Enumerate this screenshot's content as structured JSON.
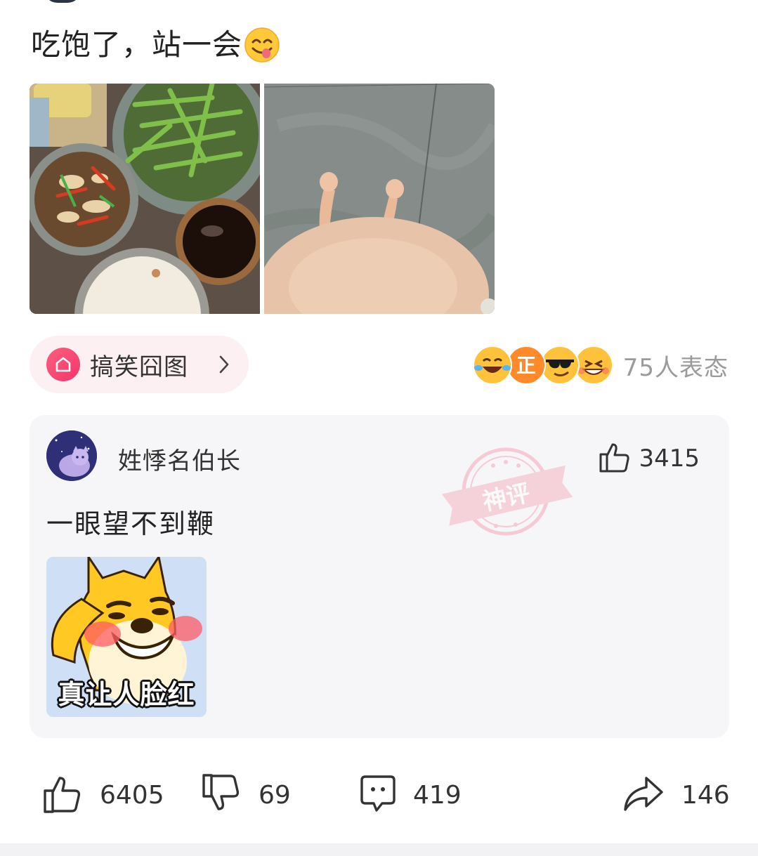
{
  "post": {
    "text": "吃饱了，站一会",
    "emoji": "savoring-food-emoji"
  },
  "topic": {
    "label": "搞笑囧图",
    "icon": "home-icon"
  },
  "reactions": {
    "count_label": "75人表态",
    "emojis": [
      "laughing-tears-emoji",
      "zheng-emoji",
      "sunglasses-emoji",
      "grinning-emoji"
    ]
  },
  "hot_comment": {
    "user_name": "姓悸名伯长",
    "like_count": "3415",
    "text": "一眼望不到鞭",
    "badge": "神评",
    "sticker_caption": "真让人脸红"
  },
  "actions": {
    "like_count": "6405",
    "dislike_count": "69",
    "comment_count": "419",
    "share_count": "146"
  },
  "colors": {
    "accent_pink": "#f2356a",
    "chip_background": "#fdf0f2",
    "card_background": "#f6f6f8"
  }
}
